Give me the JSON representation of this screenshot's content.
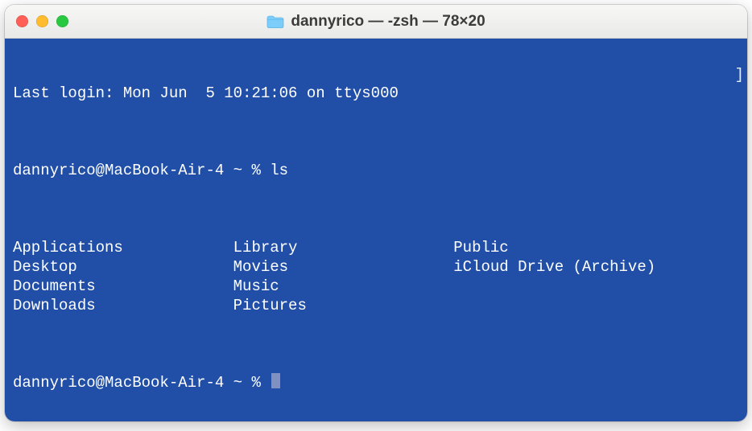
{
  "window": {
    "title": "dannyrico — -zsh — 78×20",
    "icon": "folder-icon"
  },
  "terminal": {
    "last_login": "Last login: Mon Jun  5 10:21:06 on ttys000",
    "prompt1": "dannyrico@MacBook-Air-4 ~ % ",
    "command1": "ls",
    "ls_output": {
      "col1": [
        "Applications",
        "Desktop",
        "Documents",
        "Downloads"
      ],
      "col2": [
        "Library",
        "Movies",
        "Music",
        "Pictures"
      ],
      "col3": [
        "Public",
        "iCloud Drive (Archive)",
        "",
        ""
      ]
    },
    "prompt2": "dannyrico@MacBook-Air-4 ~ % ",
    "right_marker": "]"
  },
  "colors": {
    "terminal_bg": "#214fa8",
    "terminal_fg": "#ffffff",
    "cursor": "#7f90c1"
  }
}
